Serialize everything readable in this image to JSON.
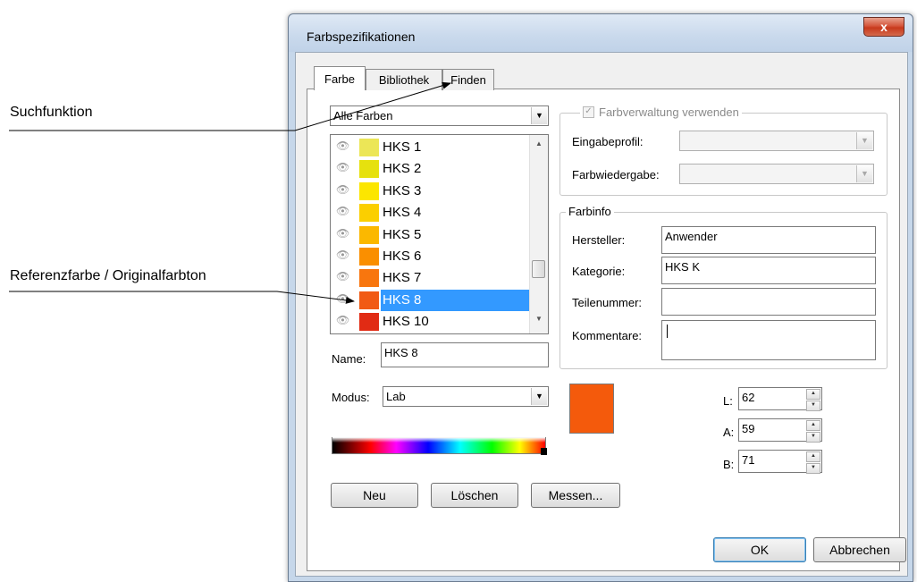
{
  "annotations": {
    "search_label": "Suchfunktion",
    "reference_label": "Referenzfarbe / Originalfarbton"
  },
  "window": {
    "title": "Farbspezifikationen",
    "close_glyph": "x"
  },
  "tabs": [
    {
      "label": "Farbe",
      "active": true
    },
    {
      "label": "Bibliothek",
      "active": false
    },
    {
      "label": "Finden",
      "active": false
    }
  ],
  "filter": {
    "selected": "Alle Farben"
  },
  "color_list": {
    "items": [
      {
        "label": "HKS 1",
        "color": "#ece657"
      },
      {
        "label": "HKS 2",
        "color": "#e6e10e"
      },
      {
        "label": "HKS 3",
        "color": "#fce600"
      },
      {
        "label": "HKS 4",
        "color": "#fbcf00"
      },
      {
        "label": "HKS 5",
        "color": "#fbb800"
      },
      {
        "label": "HKS 6",
        "color": "#fa8f00"
      },
      {
        "label": "HKS 7",
        "color": "#f8760e"
      },
      {
        "label": "HKS 8",
        "color": "#f15a14",
        "selected": true
      },
      {
        "label": "HKS 10",
        "color": "#e12b14"
      }
    ]
  },
  "name_field": {
    "label": "Name:",
    "value": "HKS 8"
  },
  "mode": {
    "label": "Modus:",
    "selected": "Lab"
  },
  "color_management": {
    "checkbox_label": "Farbverwaltung verwenden",
    "checked": true,
    "input_profile_label": "Eingabeprofil:",
    "rendering_label": "Farbwiedergabe:"
  },
  "color_info": {
    "legend": "Farbinfo",
    "manufacturer_label": "Hersteller:",
    "manufacturer_value": "Anwender",
    "category_label": "Kategorie:",
    "category_value": "HKS K",
    "part_number_label": "Teilenummer:",
    "part_number_value": "",
    "comments_label": "Kommentare:",
    "comments_value": ""
  },
  "preview_color": "#f45a0c",
  "lab": {
    "L_label": "L:",
    "L_value": "62",
    "A_label": "A:",
    "A_value": "59",
    "B_label": "B:",
    "B_value": "71"
  },
  "buttons": {
    "new": "Neu",
    "delete": "Löschen",
    "measure": "Messen...",
    "ok": "OK",
    "cancel": "Abbrechen"
  }
}
